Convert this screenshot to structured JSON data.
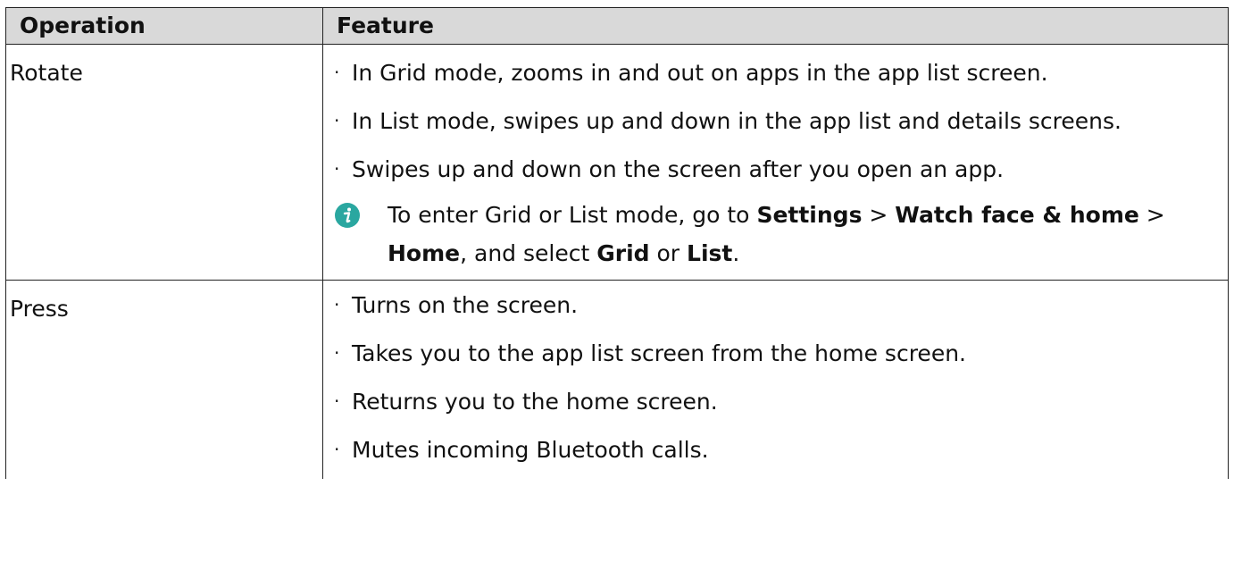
{
  "table": {
    "headers": [
      "Operation",
      "Feature"
    ],
    "rows": [
      {
        "operation": "Rotate",
        "bullets": [
          "In Grid mode, zooms in and out on apps in the app list screen.",
          "In List mode, swipes up and down in the app list and details screens.",
          "Swipes up and down on the screen after you open an app."
        ],
        "note": {
          "icon": "info-icon",
          "segments": [
            {
              "text": "To enter Grid or List mode, go to ",
              "bold": false
            },
            {
              "text": "Settings",
              "bold": true
            },
            {
              "text": " > ",
              "bold": false
            },
            {
              "text": "Watch face & home",
              "bold": true
            },
            {
              "text": " > ",
              "bold": false
            },
            {
              "text": "Home",
              "bold": true
            },
            {
              "text": ", and select ",
              "bold": false
            },
            {
              "text": "Grid",
              "bold": true
            },
            {
              "text": " or ",
              "bold": false
            },
            {
              "text": "List",
              "bold": true
            },
            {
              "text": ".",
              "bold": false
            }
          ]
        }
      },
      {
        "operation": "Press",
        "bullets": [
          "Turns on the screen.",
          "Takes you to the app list screen from the home screen.",
          "Returns you to the home screen.",
          "Mutes incoming Bluetooth calls."
        ]
      }
    ]
  },
  "colors": {
    "header_bg": "#d9d9d9",
    "border": "#222222",
    "info_icon": "#2aa7a0"
  }
}
